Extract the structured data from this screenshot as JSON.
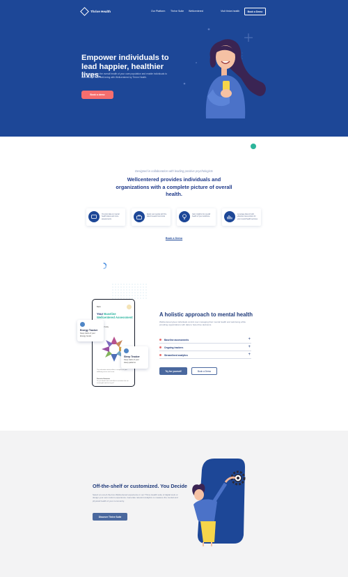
{
  "nav": {
    "brand": "Thrive Health",
    "links": [
      "Our Platform",
      "Thrive Suite",
      "Wellcentered",
      "Visit thrive.health"
    ],
    "book_demo": "Book a Demo"
  },
  "hero": {
    "headline": "Empower individuals to lead happier, healthier lives.",
    "body": "Gain insights into the overall health of your care population and enable individuals to self-manage their well-being with Wellcentered by Thrive Health.",
    "cta": "Book a demo"
  },
  "features": {
    "eyebrow": "Designed in collaboration with leading positive psychologists",
    "headline": "Wellcentered provides individuals and organizations with a complete picture of overall health.",
    "cards": [
      {
        "icon": "chat-icon",
        "text": "On-topic data on mental health status and more assessments"
      },
      {
        "icon": "bag-icon",
        "text": "Equip your people with the latest research and tools"
      },
      {
        "icon": "bulb-icon",
        "text": "Gain insights into overall health of your workforce"
      },
      {
        "icon": "chart-icon",
        "text": "Leverage data to build effective interventions for your overall health services"
      }
    ],
    "book_link": "Book a Demo"
  },
  "holistic": {
    "phone": {
      "back": "Back",
      "title_a": "Your",
      "title_b": "Baseline Wellcentered Assessment",
      "profile": "Wellness Profile",
      "para1": "The information below offers a snapshot of your wellbeing across each area.",
      "para2_title": "Pursuit of Interests",
      "para2": "Do you devote time and effort to activities that are meaningful and fun to you?"
    },
    "energy": {
      "title": "Energy Tracker",
      "desc": "Keep track of your Energy levels"
    },
    "sleep": {
      "title": "Sleep Tracker",
      "desc": "Keep track of your sleep patterns"
    },
    "title": "A holistic approach to mental health",
    "description": "Wellcentered gives individuals control over managing their mental health and well-being while providing organizations with data to help drive decisions.",
    "accordion": [
      "Baseline assessments",
      "Ongoing trackers",
      "Streamlined analytics"
    ],
    "btn_try": "Try for yourself",
    "btn_demo": "Book a Demo"
  },
  "custom": {
    "title": "Off-the-shelf or customized. You Decide",
    "description": "Select an out-of-the-box Wellcentered experience in our Thrive Health suite of digital tools or design your own custom experience. Generate relevant analytics to measure the mental and physical health of your community.",
    "cta": "Discover Thrive Suite"
  },
  "colors": {
    "primary": "#1d4797",
    "accent_coral": "#f56e6e",
    "teal": "#29b39e",
    "button_blue": "#4a689e"
  }
}
